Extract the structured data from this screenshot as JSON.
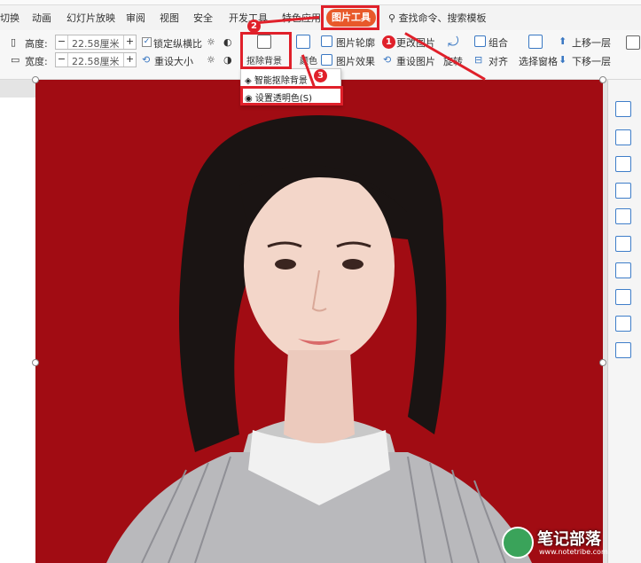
{
  "menubar": {
    "items": [
      "切换",
      "动画",
      "幻灯片放映",
      "审阅",
      "视图",
      "安全",
      "开发工具",
      "特色应用"
    ],
    "active_tab": "图片工具",
    "search": "查找命令、搜索模板"
  },
  "ribbon": {
    "height_label": "高度:",
    "height_value": "22.58厘米",
    "width_label": "宽度:",
    "width_value": "22.58厘米",
    "lock_ratio": "锁定纵横比",
    "reset_size": "重设大小",
    "remove_bg": "抠除背景",
    "color": "颜色",
    "pic_outline": "图片轮廓",
    "pic_effect": "图片效果",
    "change_pic": "更改图片",
    "reset_pic": "重设图片",
    "rotate": "旋转",
    "group": "组合",
    "align": "对齐",
    "selection_pane": "选择窗格",
    "bring_forward": "上移一层",
    "send_backward": "下移一层"
  },
  "dropdown": {
    "smart_remove": "智能抠除背景",
    "set_transparent": "设置透明色(S)"
  },
  "annotations": {
    "step1": "1",
    "step2": "2",
    "step3": "3"
  },
  "watermark": {
    "text": "笔记部落",
    "url": "www.notetribe.com"
  },
  "colors": {
    "accent": "#e8592a",
    "annotation": "#e0202a",
    "photo_bg": "#a10c13"
  }
}
